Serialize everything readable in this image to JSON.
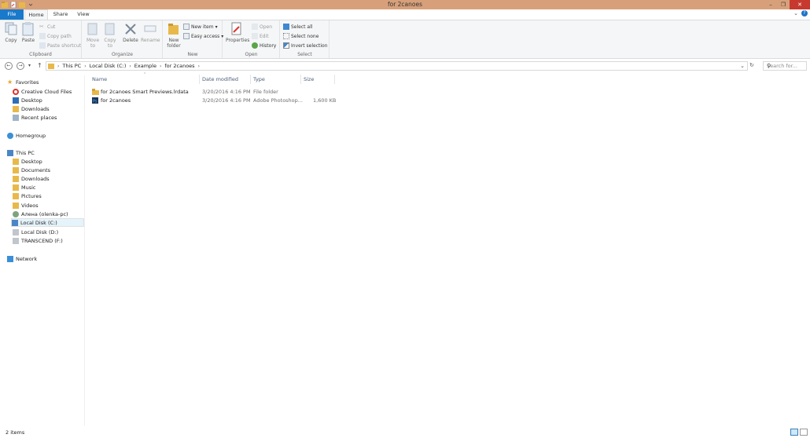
{
  "window": {
    "title": "for 2canoes"
  },
  "tabs": {
    "file": "File",
    "home": "Home",
    "share": "Share",
    "view": "View"
  },
  "ribbon": {
    "clipboard": {
      "label": "Clipboard",
      "copy": "Copy",
      "paste": "Paste",
      "cut": "Cut",
      "copy_path": "Copy path",
      "paste_shortcut": "Paste shortcut"
    },
    "organize": {
      "label": "Organize",
      "move_to": "Move to",
      "copy_to": "Copy to",
      "delete": "Delete",
      "rename": "Rename"
    },
    "new": {
      "label": "New",
      "new_folder": "New folder",
      "new_item": "New item",
      "easy_access": "Easy access"
    },
    "open": {
      "label": "Open",
      "properties": "Properties",
      "open": "Open",
      "edit": "Edit",
      "history": "History"
    },
    "select": {
      "label": "Select",
      "select_all": "Select all",
      "select_none": "Select none",
      "invert_selection": "Invert selection"
    }
  },
  "address": {
    "crumbs": [
      "This PC",
      "Local Disk (C:)",
      "Example",
      "for 2canoes"
    ],
    "search_placeholder": "Search for..."
  },
  "nav": {
    "favorites": "Favorites",
    "favorites_items": [
      "Creative Cloud Files",
      "Desktop",
      "Downloads",
      "Recent places"
    ],
    "homegroup": "Homegroup",
    "this_pc": "This PC",
    "pc_items": [
      "Desktop",
      "Documents",
      "Downloads",
      "Music",
      "Pictures",
      "Videos",
      "Алена (olenka-pc)",
      "Local Disk (C:)",
      "Local Disk (D:)",
      "TRANSCEND (F:)"
    ],
    "network": "Network"
  },
  "columns": {
    "name": "Name",
    "date": "Date modified",
    "type": "Type",
    "size": "Size"
  },
  "files": [
    {
      "name": "for 2canoes Smart Previews.lrdata",
      "date": "3/20/2016 4:16 PM",
      "type": "File folder",
      "size": ""
    },
    {
      "name": "for 2canoes",
      "date": "3/20/2016 4:16 PM",
      "type": "Adobe Photoshop...",
      "size": "1,600 KB"
    }
  ],
  "status": {
    "count": "2 items"
  },
  "colors": {
    "titlebar": "#d7a07a",
    "file_tab": "#1979ca",
    "close": "#c7392e",
    "folder": "#e8b94a"
  }
}
